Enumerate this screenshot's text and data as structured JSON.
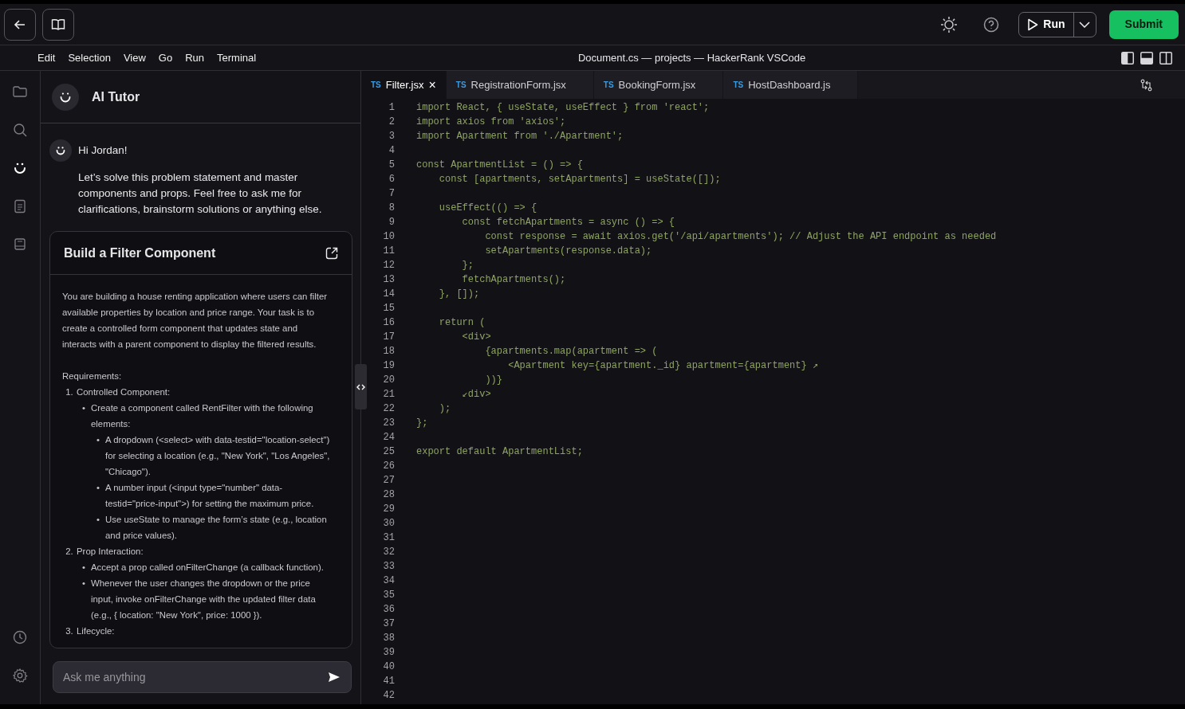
{
  "toolbar": {
    "run_label": "Run",
    "submit_label": "Submit"
  },
  "menu": [
    {
      "label": "Edit"
    },
    {
      "label": "Selection"
    },
    {
      "label": "View"
    },
    {
      "label": "Go"
    },
    {
      "label": "Run"
    },
    {
      "label": "Terminal"
    }
  ],
  "window_title": "Document.cs — projects — HackerRank VSCode",
  "layout_toggles": [
    {
      "kind": "left",
      "on": true
    },
    {
      "kind": "bottom",
      "on": true
    },
    {
      "kind": "right",
      "on": false
    }
  ],
  "activity_bar": [
    {
      "kind": "folder",
      "selected": false
    },
    {
      "kind": "search",
      "selected": false
    },
    {
      "kind": "tutor",
      "selected": true
    },
    {
      "kind": "document",
      "selected": false
    },
    {
      "kind": "notes",
      "selected": false
    }
  ],
  "activity_bar_bottom": [
    {
      "kind": "history"
    },
    {
      "kind": "settings"
    }
  ],
  "chat": {
    "title": "AI Tutor",
    "greeting": "Hi Jordan!",
    "message": "Let’s solve this problem statement and master components and props. Feel free to ask me for clarifications, brainstorm solutions or anything else.",
    "card": {
      "title": "Build a Filter Component",
      "intro": "You are building a house renting application where users can filter available properties by location and price range. Your task is to create a controlled form component that updates state and interacts with a parent component to display the filtered results.",
      "requirements_heading": "Requirements:",
      "items": [
        {
          "marker": "1.",
          "text": "Controlled Component:",
          "children": [
            {
              "marker": "•",
              "text": "Create a component called RentFilter with the following elements:",
              "children": [
                {
                  "marker": "•",
                  "text": "A dropdown (<select> with data-testid=\"location-select\") for selecting a location (e.g., \"New York\", \"Los Angeles\", \"Chicago\")."
                },
                {
                  "marker": "•",
                  "text": "A number input (<input type=\"number\" data-testid=\"price-input\">) for setting the maximum price."
                },
                {
                  "marker": "•",
                  "text": "Use useState to manage the form’s state (e.g., location and price values)."
                }
              ]
            }
          ]
        },
        {
          "marker": "2.",
          "text": "Prop Interaction:",
          "children": [
            {
              "marker": "•",
              "text": "Accept a prop called onFilterChange (a callback function)."
            },
            {
              "marker": "•",
              "text": "Whenever the user changes the dropdown or the price input, invoke onFilterChange with the updated filter data (e.g., { location: \"New York\", price: 1000 })."
            }
          ]
        },
        {
          "marker": "3.",
          "text": "Lifecycle:"
        }
      ]
    },
    "input": {
      "placeholder": "Ask me anything"
    }
  },
  "tabs": [
    {
      "badge": "TS",
      "label": "Filter.jsx",
      "selected": true,
      "close_glyph": "×"
    },
    {
      "badge": "TS",
      "label": "RegistrationForm.jsx",
      "selected": false
    },
    {
      "badge": "TS",
      "label": "BookingForm.jsx",
      "selected": false
    },
    {
      "badge": "TS",
      "label": "HostDashboard.js",
      "selected": false
    }
  ],
  "code_lines": [
    {
      "number": "1",
      "text": "import React, { useState, useEffect } from 'react';"
    },
    {
      "number": "2",
      "text": "import axios from 'axios';"
    },
    {
      "number": "3",
      "text": "import Apartment from './Apartment';"
    },
    {
      "number": "4"
    },
    {
      "number": "5",
      "text": "const ApartmentList = () => {"
    },
    {
      "number": "6",
      "text": "    const [apartments, setApartments] = useState([]);"
    },
    {
      "number": "7"
    },
    {
      "number": "8",
      "text": "    useEffect(() => {"
    },
    {
      "number": "9",
      "text": "        const fetchApartments = async () => {"
    },
    {
      "number": "10",
      "text": "            const response = await axios.get('/api/apartments'); // Adjust the API endpoint as needed"
    },
    {
      "number": "11",
      "text": "            setApartments(response.data);"
    },
    {
      "number": "12",
      "text": "        };"
    },
    {
      "number": "13",
      "text": "        fetchApartments();"
    },
    {
      "number": "14",
      "text": "    }, []);"
    },
    {
      "number": "15"
    },
    {
      "number": "16",
      "text": "    return ("
    },
    {
      "number": "17",
      "text": "        <div>"
    },
    {
      "number": "18",
      "text": "            {apartments.map(apartment => ("
    },
    {
      "number": "19",
      "text": "                <Apartment key={apartment._id} apartment={apartment} ↗"
    },
    {
      "number": "20",
      "text": "            ))}"
    },
    {
      "number": "21",
      "text": "        ↙div>"
    },
    {
      "number": "22",
      "text": "    );"
    },
    {
      "number": "23",
      "text": "};"
    },
    {
      "number": "24"
    },
    {
      "number": "25",
      "text": "export default ApartmentList;"
    },
    {
      "number": "26"
    },
    {
      "number": "27"
    },
    {
      "number": "28"
    },
    {
      "number": "29"
    },
    {
      "number": "30"
    },
    {
      "number": "31"
    },
    {
      "number": "32"
    },
    {
      "number": "33"
    },
    {
      "number": "34"
    },
    {
      "number": "35"
    },
    {
      "number": "36"
    },
    {
      "number": "37"
    },
    {
      "number": "38"
    },
    {
      "number": "39"
    },
    {
      "number": "40"
    },
    {
      "number": "41"
    },
    {
      "number": "42"
    }
  ]
}
